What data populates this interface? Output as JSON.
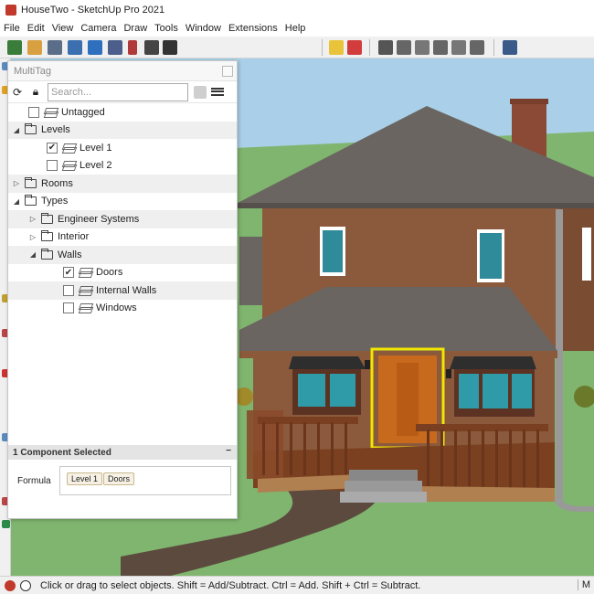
{
  "window": {
    "title": "HouseTwo - SketchUp Pro 2021"
  },
  "menu": [
    "File",
    "Edit",
    "View",
    "Camera",
    "Draw",
    "Tools",
    "Window",
    "Extensions",
    "Help"
  ],
  "panel": {
    "title": "MultiTag",
    "search_placeholder": "Search...",
    "tree": [
      {
        "label": "Untagged",
        "type": "tag",
        "depth": 1,
        "checked": false,
        "alt": false
      },
      {
        "label": "Levels",
        "type": "folder",
        "depth": 0,
        "expanded": true,
        "alt": true
      },
      {
        "label": "Level 1",
        "type": "tag",
        "depth": 2,
        "checked": true,
        "alt": false
      },
      {
        "label": "Level 2",
        "type": "tag",
        "depth": 2,
        "checked": false,
        "alt": false
      },
      {
        "label": "Rooms",
        "type": "folder",
        "depth": 0,
        "expanded": false,
        "alt": true
      },
      {
        "label": "Types",
        "type": "folder",
        "depth": 0,
        "expanded": true,
        "alt": false
      },
      {
        "label": "Engineer Systems",
        "type": "folder",
        "depth": 1,
        "expanded": false,
        "alt": true
      },
      {
        "label": "Interior",
        "type": "folder",
        "depth": 1,
        "expanded": false,
        "alt": false
      },
      {
        "label": "Walls",
        "type": "folder",
        "depth": 1,
        "expanded": true,
        "alt": true
      },
      {
        "label": "Doors",
        "type": "tag",
        "depth": 3,
        "checked": true,
        "alt": false
      },
      {
        "label": "Internal Walls",
        "type": "tag",
        "depth": 3,
        "checked": false,
        "alt": true
      },
      {
        "label": "Windows",
        "type": "tag",
        "depth": 3,
        "checked": false,
        "alt": false
      }
    ],
    "selection_status": "1 Component Selected",
    "collapse_symbol": "−",
    "formula_label": "Formula",
    "formula_chips": [
      "Level 1",
      "Doors"
    ]
  },
  "status": {
    "text": "Click or drag to select objects. Shift = Add/Subtract. Ctrl = Add. Shift + Ctrl = Subtract.",
    "right": "M"
  },
  "colors": {
    "sky": "#a9d0e8",
    "grass": "#7fb56e",
    "brick": "#8b5a3c",
    "roof": "#6b6561",
    "selection": "#f2e600"
  }
}
